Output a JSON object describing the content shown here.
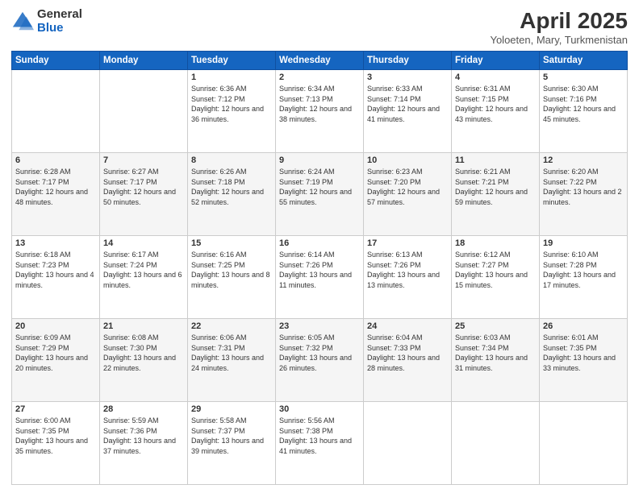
{
  "header": {
    "logo_general": "General",
    "logo_blue": "Blue",
    "month_title": "April 2025",
    "location": "Yoloeten, Mary, Turkmenistan"
  },
  "days_of_week": [
    "Sunday",
    "Monday",
    "Tuesday",
    "Wednesday",
    "Thursday",
    "Friday",
    "Saturday"
  ],
  "weeks": [
    [
      {
        "day": "",
        "info": ""
      },
      {
        "day": "",
        "info": ""
      },
      {
        "day": "1",
        "info": "Sunrise: 6:36 AM\nSunset: 7:12 PM\nDaylight: 12 hours and 36 minutes."
      },
      {
        "day": "2",
        "info": "Sunrise: 6:34 AM\nSunset: 7:13 PM\nDaylight: 12 hours and 38 minutes."
      },
      {
        "day": "3",
        "info": "Sunrise: 6:33 AM\nSunset: 7:14 PM\nDaylight: 12 hours and 41 minutes."
      },
      {
        "day": "4",
        "info": "Sunrise: 6:31 AM\nSunset: 7:15 PM\nDaylight: 12 hours and 43 minutes."
      },
      {
        "day": "5",
        "info": "Sunrise: 6:30 AM\nSunset: 7:16 PM\nDaylight: 12 hours and 45 minutes."
      }
    ],
    [
      {
        "day": "6",
        "info": "Sunrise: 6:28 AM\nSunset: 7:17 PM\nDaylight: 12 hours and 48 minutes."
      },
      {
        "day": "7",
        "info": "Sunrise: 6:27 AM\nSunset: 7:17 PM\nDaylight: 12 hours and 50 minutes."
      },
      {
        "day": "8",
        "info": "Sunrise: 6:26 AM\nSunset: 7:18 PM\nDaylight: 12 hours and 52 minutes."
      },
      {
        "day": "9",
        "info": "Sunrise: 6:24 AM\nSunset: 7:19 PM\nDaylight: 12 hours and 55 minutes."
      },
      {
        "day": "10",
        "info": "Sunrise: 6:23 AM\nSunset: 7:20 PM\nDaylight: 12 hours and 57 minutes."
      },
      {
        "day": "11",
        "info": "Sunrise: 6:21 AM\nSunset: 7:21 PM\nDaylight: 12 hours and 59 minutes."
      },
      {
        "day": "12",
        "info": "Sunrise: 6:20 AM\nSunset: 7:22 PM\nDaylight: 13 hours and 2 minutes."
      }
    ],
    [
      {
        "day": "13",
        "info": "Sunrise: 6:18 AM\nSunset: 7:23 PM\nDaylight: 13 hours and 4 minutes."
      },
      {
        "day": "14",
        "info": "Sunrise: 6:17 AM\nSunset: 7:24 PM\nDaylight: 13 hours and 6 minutes."
      },
      {
        "day": "15",
        "info": "Sunrise: 6:16 AM\nSunset: 7:25 PM\nDaylight: 13 hours and 8 minutes."
      },
      {
        "day": "16",
        "info": "Sunrise: 6:14 AM\nSunset: 7:26 PM\nDaylight: 13 hours and 11 minutes."
      },
      {
        "day": "17",
        "info": "Sunrise: 6:13 AM\nSunset: 7:26 PM\nDaylight: 13 hours and 13 minutes."
      },
      {
        "day": "18",
        "info": "Sunrise: 6:12 AM\nSunset: 7:27 PM\nDaylight: 13 hours and 15 minutes."
      },
      {
        "day": "19",
        "info": "Sunrise: 6:10 AM\nSunset: 7:28 PM\nDaylight: 13 hours and 17 minutes."
      }
    ],
    [
      {
        "day": "20",
        "info": "Sunrise: 6:09 AM\nSunset: 7:29 PM\nDaylight: 13 hours and 20 minutes."
      },
      {
        "day": "21",
        "info": "Sunrise: 6:08 AM\nSunset: 7:30 PM\nDaylight: 13 hours and 22 minutes."
      },
      {
        "day": "22",
        "info": "Sunrise: 6:06 AM\nSunset: 7:31 PM\nDaylight: 13 hours and 24 minutes."
      },
      {
        "day": "23",
        "info": "Sunrise: 6:05 AM\nSunset: 7:32 PM\nDaylight: 13 hours and 26 minutes."
      },
      {
        "day": "24",
        "info": "Sunrise: 6:04 AM\nSunset: 7:33 PM\nDaylight: 13 hours and 28 minutes."
      },
      {
        "day": "25",
        "info": "Sunrise: 6:03 AM\nSunset: 7:34 PM\nDaylight: 13 hours and 31 minutes."
      },
      {
        "day": "26",
        "info": "Sunrise: 6:01 AM\nSunset: 7:35 PM\nDaylight: 13 hours and 33 minutes."
      }
    ],
    [
      {
        "day": "27",
        "info": "Sunrise: 6:00 AM\nSunset: 7:35 PM\nDaylight: 13 hours and 35 minutes."
      },
      {
        "day": "28",
        "info": "Sunrise: 5:59 AM\nSunset: 7:36 PM\nDaylight: 13 hours and 37 minutes."
      },
      {
        "day": "29",
        "info": "Sunrise: 5:58 AM\nSunset: 7:37 PM\nDaylight: 13 hours and 39 minutes."
      },
      {
        "day": "30",
        "info": "Sunrise: 5:56 AM\nSunset: 7:38 PM\nDaylight: 13 hours and 41 minutes."
      },
      {
        "day": "",
        "info": ""
      },
      {
        "day": "",
        "info": ""
      },
      {
        "day": "",
        "info": ""
      }
    ]
  ]
}
